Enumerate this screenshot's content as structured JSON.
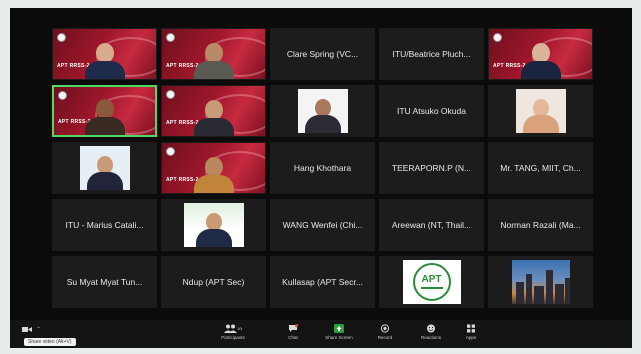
{
  "participants": [
    {
      "type": "brand",
      "tag": "APT RRSS-2"
    },
    {
      "type": "brand",
      "tag": "APT RRSS-2"
    },
    {
      "type": "name",
      "name": "Clare Spring (VC..."
    },
    {
      "type": "name",
      "name": "ITU/Beatrice Pluch..."
    },
    {
      "type": "brand",
      "tag": "APT RRSS-2"
    },
    {
      "type": "brand",
      "tag": "APT RRSS-2",
      "active": true
    },
    {
      "type": "brand",
      "tag": "APT RRSS-2"
    },
    {
      "type": "photo"
    },
    {
      "type": "name",
      "name": "ITU Atsuko Okuda"
    },
    {
      "type": "photo"
    },
    {
      "type": "photo"
    },
    {
      "type": "brand",
      "tag": "APT RRSS-2"
    },
    {
      "type": "name",
      "name": "Hang Khothara"
    },
    {
      "type": "name",
      "name": "TEERAPORN.P (N..."
    },
    {
      "type": "name",
      "name": "Mr. TANG, MIIT, Ch..."
    },
    {
      "type": "name",
      "name": "ITU - Marius Catali..."
    },
    {
      "type": "photo"
    },
    {
      "type": "name",
      "name": "WANG Wenfei (Chi..."
    },
    {
      "type": "name",
      "name": "Areewan (NT, Thail..."
    },
    {
      "type": "name",
      "name": "Norman Razali (Ma..."
    },
    {
      "type": "name",
      "name": "Su Myat Myat Tun..."
    },
    {
      "type": "name",
      "name": "Ndup (APT Sec)"
    },
    {
      "type": "name",
      "name": "Kullasap (APT Secr..."
    },
    {
      "type": "logo",
      "logo_text": "APT"
    },
    {
      "type": "city"
    }
  ],
  "toolbar": {
    "participants_label": "Participants",
    "participants_count": "100",
    "chat_label": "Chat",
    "chat_badge": "1",
    "share_label": "Share Screen",
    "record_label": "Record",
    "reactions_label": "Reactions",
    "apps_label": "Apps",
    "tooltip": "Share video (Alt+V)"
  },
  "colors": {
    "active_border": "#4cd964",
    "share_green": "#2d9d3f",
    "brand_red": "#a0172b"
  }
}
